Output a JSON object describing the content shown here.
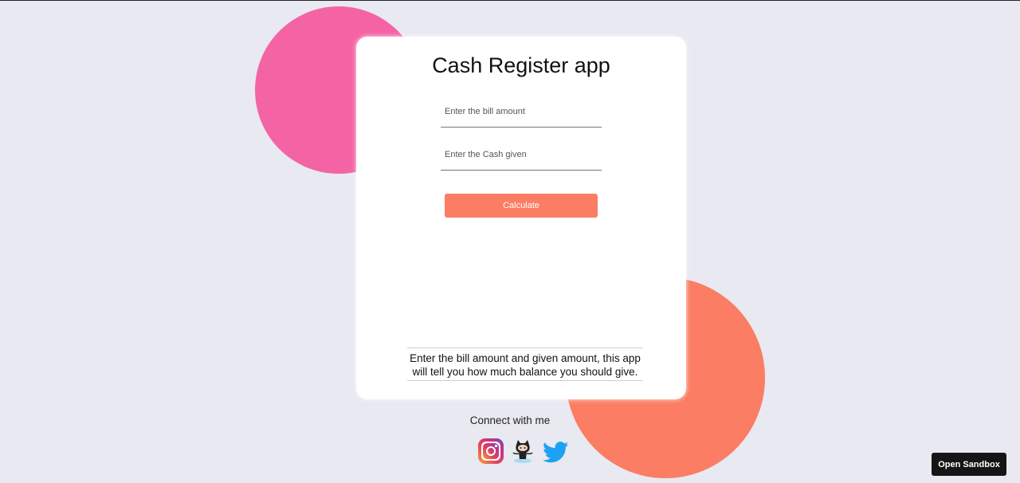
{
  "app": {
    "title": "Cash Register app",
    "bill_input": {
      "placeholder": "Enter the bill amount",
      "value": ""
    },
    "cash_input": {
      "placeholder": "Enter the Cash given",
      "value": ""
    },
    "calculate_label": "Calculate",
    "description": "Enter the bill amount and given amount, this app will tell you how much balance you should give."
  },
  "footer": {
    "connect_text": "Connect with me",
    "social_icons": [
      "instagram-icon",
      "github-icon",
      "twitter-icon"
    ]
  },
  "sandbox": {
    "label": "Open Sandbox"
  },
  "colors": {
    "background": "#e9e9f1",
    "pink_circle": "#f464a5",
    "accent": "#fb7d63",
    "card": "#ffffff",
    "sandbox_button": "#151515"
  }
}
